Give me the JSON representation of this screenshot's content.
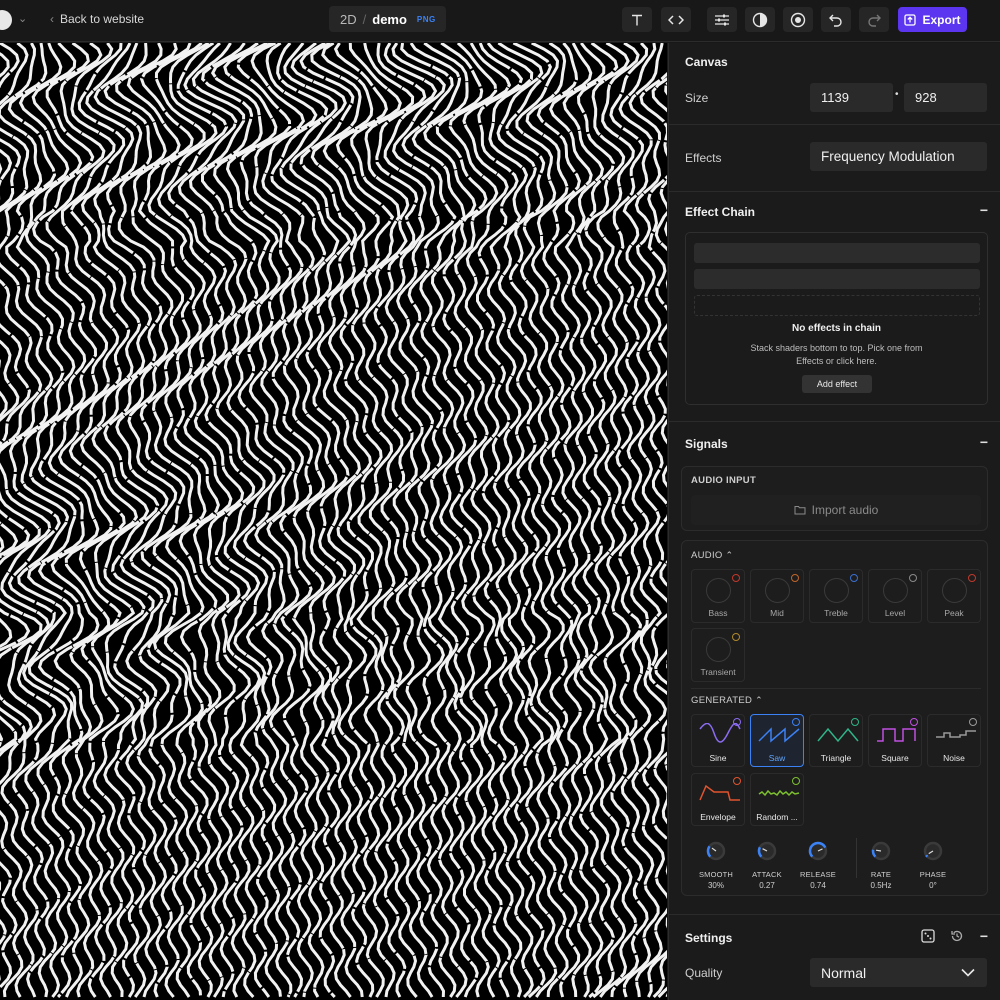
{
  "topbar": {
    "back_label": "Back to website",
    "file_mode": "2D",
    "file_separator": "/",
    "file_name": "demo",
    "file_format": "PNG",
    "export_label": "Export",
    "icons": [
      "text-icon",
      "code-icon",
      "sliders-icon",
      "contrast-icon",
      "record-icon",
      "undo-icon",
      "redo-icon"
    ]
  },
  "canvas": {
    "title": "Canvas",
    "size_label": "Size",
    "width": "1139",
    "height": "928",
    "size_separator": "•",
    "effects_label": "Effects",
    "effects_value": "Frequency Modulation"
  },
  "effect_chain": {
    "title": "Effect Chain",
    "collapse": "−",
    "empty_title": "No effects in chain",
    "empty_desc_1": "Stack shaders bottom to top. Pick one from",
    "empty_desc_2": "Effects or click here.",
    "add_label": "Add effect"
  },
  "signals": {
    "title": "Signals",
    "collapse": "−",
    "audio_input_title": "AUDIO INPUT",
    "import_label": "Import audio",
    "audio_title": "AUDIO",
    "audio_bands": [
      {
        "label": "Bass",
        "color": "#c0392b"
      },
      {
        "label": "Mid",
        "color": "#c0652b"
      },
      {
        "label": "Treble",
        "color": "#3b6fd0"
      },
      {
        "label": "Level",
        "color": "#8a8a8a"
      },
      {
        "label": "Peak",
        "color": "#c0392b"
      },
      {
        "label": "Transient",
        "color": "#b08a2b"
      }
    ],
    "generated_title": "GENERATED",
    "generators": [
      {
        "label": "Sine",
        "color": "#8b6cf0",
        "selected": false
      },
      {
        "label": "Saw",
        "color": "#3b82f6",
        "selected": true
      },
      {
        "label": "Triangle",
        "color": "#2fb58a",
        "selected": false
      },
      {
        "label": "Square",
        "color": "#c050e0",
        "selected": false
      },
      {
        "label": "Noise",
        "color": "#9a9a9a",
        "selected": false
      },
      {
        "label": "Envelope",
        "color": "#e0552f",
        "selected": false
      },
      {
        "label": "Random ...",
        "color": "#7cc02f",
        "selected": false
      }
    ],
    "params": [
      {
        "name": "SMOOTH",
        "value": "30%",
        "level": 0.3
      },
      {
        "name": "ATTACK",
        "value": "0.27",
        "level": 0.27
      },
      {
        "name": "RELEASE",
        "value": "0.74",
        "level": 0.74
      },
      {
        "name": "RATE",
        "value": "0.5Hz",
        "level": 0.2
      },
      {
        "name": "PHASE",
        "value": "0°",
        "level": 0.05
      }
    ]
  },
  "settings": {
    "title": "Settings",
    "collapse": "−",
    "quality_label": "Quality",
    "quality_value": "Normal"
  },
  "colors": {
    "accent": "#5b35f0",
    "selection": "#3b82f6"
  }
}
